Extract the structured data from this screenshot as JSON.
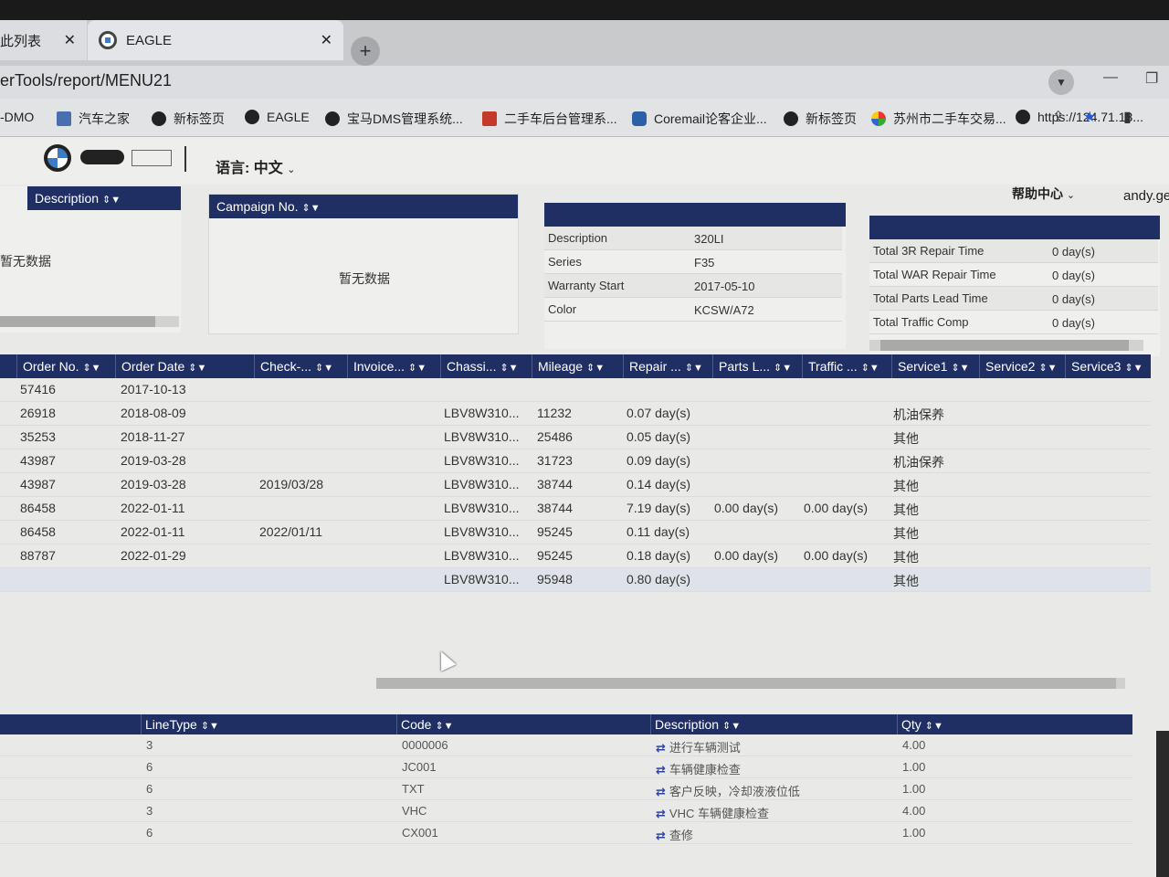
{
  "browser": {
    "tabs": [
      {
        "label": "此列表",
        "active": false
      },
      {
        "label": "EAGLE",
        "active": true
      }
    ],
    "url": "erTools/report/MENU21",
    "bookmarks": [
      "-DMO",
      "汽车之家",
      "新标签页",
      "EAGLE",
      "宝马DMS管理系统...",
      "二手车后台管理系...",
      "Coremail论客企业...",
      "新标签页",
      "苏州市二手车交易...",
      "https://124.71.13..."
    ]
  },
  "header": {
    "language": "语言: 中文",
    "help": "帮助中心",
    "user": "andy.ge"
  },
  "panel_description": {
    "header": "Description",
    "empty": "暂无数据"
  },
  "panel_campaign": {
    "header": "Campaign No.",
    "empty": "暂无数据"
  },
  "panel_vehicle": {
    "rows": [
      {
        "label": "Description",
        "value": "320LI"
      },
      {
        "label": "Series",
        "value": "F35"
      },
      {
        "label": "Warranty Start",
        "value": "2017-05-10"
      },
      {
        "label": "Color",
        "value": "KCSW/A72"
      }
    ]
  },
  "panel_totals": {
    "rows": [
      {
        "label": "Total 3R Repair Time",
        "value": "0 day(s)"
      },
      {
        "label": "Total WAR Repair Time",
        "value": "0 day(s)"
      },
      {
        "label": "Total Parts Lead Time",
        "value": "0 day(s)"
      },
      {
        "label": "Total Traffic Comp",
        "value": "0 day(s)"
      }
    ]
  },
  "orders": {
    "columns": [
      "Order No.",
      "Order Date",
      "Check-...",
      "Invoice...",
      "Chassi...",
      "Mileage",
      "Repair ...",
      "Parts L...",
      "Traffic ...",
      "Service1",
      "Service2",
      "Service3"
    ],
    "rows": [
      {
        "order": "57416",
        "date": "2017-10-13",
        "check": "",
        "invoice": "",
        "chassis": "",
        "mileage": "",
        "repair": "",
        "parts": "",
        "traffic": "",
        "s1": "",
        "s2": "",
        "s3": ""
      },
      {
        "order": "26918",
        "date": "2018-08-09",
        "check": "",
        "invoice": "",
        "chassis": "LBV8W310...",
        "mileage": "11232",
        "repair": "0.07 day(s)",
        "parts": "",
        "traffic": "",
        "s1": "机油保养",
        "s2": "",
        "s3": ""
      },
      {
        "order": "35253",
        "date": "2018-11-27",
        "check": "",
        "invoice": "",
        "chassis": "LBV8W310...",
        "mileage": "25486",
        "repair": "0.05 day(s)",
        "parts": "",
        "traffic": "",
        "s1": "其他",
        "s2": "",
        "s3": ""
      },
      {
        "order": "43987",
        "date": "2019-03-28",
        "check": "",
        "invoice": "",
        "chassis": "LBV8W310...",
        "mileage": "31723",
        "repair": "0.09 day(s)",
        "parts": "",
        "traffic": "",
        "s1": "机油保养",
        "s2": "",
        "s3": ""
      },
      {
        "order": "43987",
        "date": "2019-03-28",
        "check": "2019/03/28",
        "invoice": "",
        "chassis": "LBV8W310...",
        "mileage": "38744",
        "repair": "0.14 day(s)",
        "parts": "",
        "traffic": "",
        "s1": "其他",
        "s2": "",
        "s3": ""
      },
      {
        "order": "86458",
        "date": "2022-01-11",
        "check": "",
        "invoice": "",
        "chassis": "LBV8W310...",
        "mileage": "38744",
        "repair": "7.19 day(s)",
        "parts": "0.00 day(s)",
        "traffic": "0.00 day(s)",
        "s1": "其他",
        "s2": "",
        "s3": ""
      },
      {
        "order": "86458",
        "date": "2022-01-11",
        "check": "2022/01/11",
        "invoice": "",
        "chassis": "LBV8W310...",
        "mileage": "95245",
        "repair": "0.11 day(s)",
        "parts": "",
        "traffic": "",
        "s1": "其他",
        "s2": "",
        "s3": ""
      },
      {
        "order": "88787",
        "date": "2022-01-29",
        "check": "",
        "invoice": "",
        "chassis": "LBV8W310...",
        "mileage": "95245",
        "repair": "0.18 day(s)",
        "parts": "0.00 day(s)",
        "traffic": "0.00 day(s)",
        "s1": "其他",
        "s2": "",
        "s3": ""
      },
      {
        "order": "",
        "date": "",
        "check": "",
        "invoice": "",
        "chassis": "LBV8W310...",
        "mileage": "95948",
        "repair": "0.80 day(s)",
        "parts": "",
        "traffic": "",
        "s1": "其他",
        "s2": "",
        "s3": ""
      }
    ]
  },
  "lines": {
    "columns": [
      "LineType",
      "Code",
      "Description",
      "Qty"
    ],
    "rows": [
      {
        "type": "3",
        "code": "0000006",
        "desc": "进行车辆测试",
        "qty": "4.00"
      },
      {
        "type": "6",
        "code": "JC001",
        "desc": "车辆健康检查",
        "qty": "1.00"
      },
      {
        "type": "6",
        "code": "TXT",
        "desc": "客户反映，冷却液液位低",
        "qty": "1.00"
      },
      {
        "type": "3",
        "code": "VHC",
        "desc": "VHC 车辆健康检查",
        "qty": "4.00"
      },
      {
        "type": "6",
        "code": "CX001",
        "desc": "查修",
        "qty": "1.00"
      }
    ]
  },
  "colors": {
    "header_navy": "#1f2f63",
    "swap_icon": "#2a44a8"
  }
}
